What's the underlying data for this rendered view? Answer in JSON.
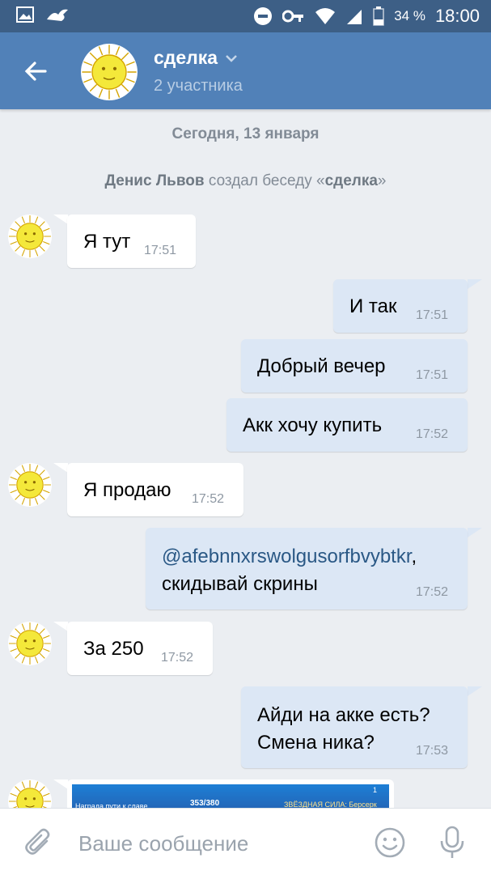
{
  "status_bar": {
    "battery_percent": "34 %",
    "time": "18:00",
    "icons": [
      "gallery-icon",
      "bird-icon",
      "dnd-icon",
      "key-icon",
      "wifi-icon",
      "signal-icon",
      "battery-icon"
    ]
  },
  "header": {
    "title": "сделка",
    "subtitle": "2 участника"
  },
  "conversation": {
    "date_separator": "Сегодня, 13 января",
    "system_message": {
      "author": "Денис Львов",
      "action": " создал беседу «",
      "chat_name": "сделка",
      "close": "»"
    },
    "messages": [
      {
        "direction": "in",
        "text": "Я тут",
        "time": "17:51"
      },
      {
        "direction": "out",
        "text": "И так",
        "time": "17:51"
      },
      {
        "direction": "out",
        "text": "Добрый вечер",
        "time": "17:51"
      },
      {
        "direction": "out",
        "text": "Акк хочу купить",
        "time": "17:52"
      },
      {
        "direction": "in",
        "text": "Я продаю",
        "time": "17:52"
      },
      {
        "direction": "out",
        "mention": "@afebnnxrswolgusorfbvybtkr",
        "mention_suffix": ",",
        "text": "скидывай скрины",
        "time": "17:52"
      },
      {
        "direction": "in",
        "text": "За 250",
        "time": "17:52"
      },
      {
        "direction": "out",
        "line1": "Айди на акке есть?",
        "line2": "Смена ника?",
        "time": "17:53"
      }
    ],
    "image_preview": {
      "label_left": "Награда пути к славе",
      "label_mid": "353/380",
      "label_right": "ЗВЁЗДНАЯ СИЛА: Берсерк",
      "badge": "1"
    }
  },
  "composer": {
    "placeholder": "Ваше сообщение"
  },
  "colors": {
    "status_bar": "#3d5f86",
    "header": "#5181b8",
    "background": "#ebeef2",
    "outgoing_bubble": "#dce7f5",
    "incoming_bubble": "#ffffff"
  }
}
